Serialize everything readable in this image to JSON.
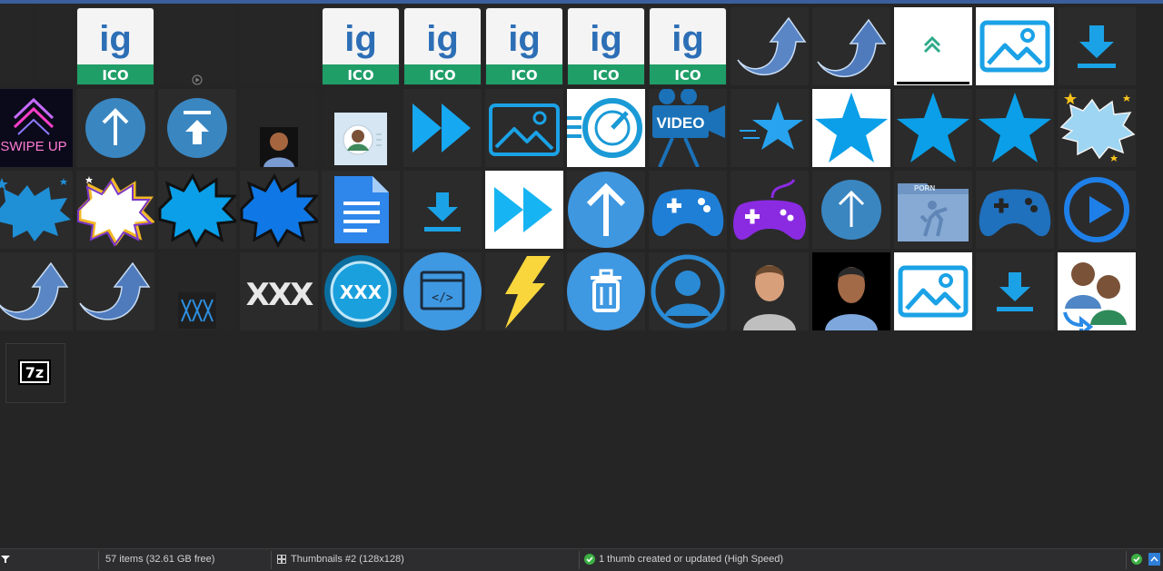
{
  "status": {
    "items_text": "57 items (32.61 GB free)",
    "view_text": "Thumbnails #2 (128x128)",
    "message_text": "1 thumb created or updated (High Speed)"
  },
  "thumbnails": {
    "ico_label": "ICO",
    "ig_label": "ig",
    "swipe_label": "SWIPE UP",
    "video_label": "VIDEO",
    "xxx_label": "XXX",
    "xxx_circle_label": "XXX",
    "porn_label": "PORN",
    "code_label": "</>",
    "sevenzip_label": "7z"
  },
  "colors": {
    "accent": "#0a9fe8",
    "ico_green": "#1f9e68",
    "tile_bg": "#2b2b2b",
    "page_bg": "#252526",
    "status_bg": "#2d2d30",
    "check_green": "#3cb043"
  }
}
